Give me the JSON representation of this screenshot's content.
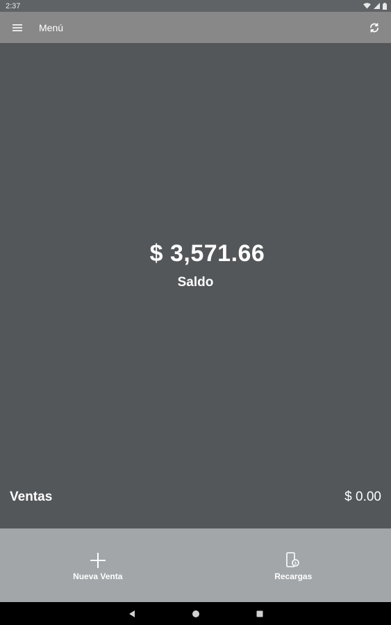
{
  "status_bar": {
    "time": "2:37"
  },
  "app_bar": {
    "title": "Menú"
  },
  "balance": {
    "amount": "$ 3,571.66",
    "label": "Saldo"
  },
  "sales": {
    "label": "Ventas",
    "value": "$ 0.00"
  },
  "bottom_actions": [
    {
      "label": "Nueva Venta",
      "icon": "plus-icon"
    },
    {
      "label": "Recargas",
      "icon": "phone-recharge-icon"
    }
  ],
  "colors": {
    "app_bar": "#888888",
    "main_bg": "#53575a",
    "bottom_bar": "#a2a6a9",
    "nav_bar": "#000000"
  }
}
